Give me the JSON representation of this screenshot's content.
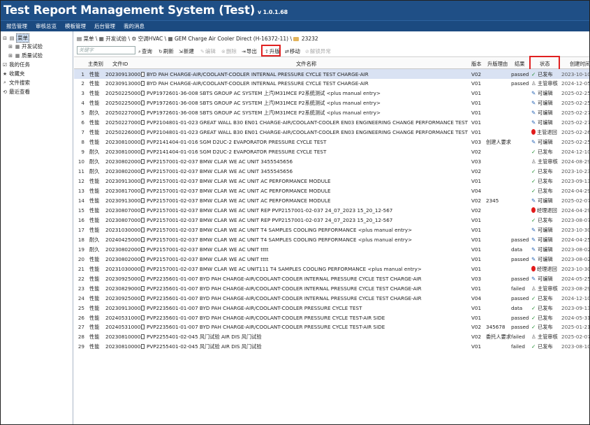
{
  "app": {
    "title": "Test Report Management System (Test)",
    "version": "v 1.0.1.68"
  },
  "nav": [
    "报告管理",
    "审核总览",
    "模板管理",
    "后台管理",
    "我的消息"
  ],
  "sidebar": {
    "items": [
      {
        "label": "菜单",
        "icon": "menu-icon"
      },
      {
        "label": "开发试验",
        "icon": "expand-icon"
      },
      {
        "label": "质量试验",
        "icon": "expand-icon"
      },
      {
        "label": "我的任务",
        "icon": "task-icon"
      },
      {
        "label": "收藏夹",
        "icon": "star-icon"
      },
      {
        "label": "文件搜索",
        "icon": "search-icon"
      },
      {
        "label": "最近查看",
        "icon": "history-icon"
      }
    ]
  },
  "breadcrumb": [
    "菜单",
    "开发试验",
    "空调HVAC",
    "GEM Charge Air Cooler Direct (H-16372-11)",
    "23232"
  ],
  "search": {
    "placeholder": "关键字"
  },
  "toolbar": [
    {
      "label": "查询",
      "glyph": "⌕",
      "enabled": true
    },
    {
      "label": "刷新",
      "glyph": "↻",
      "enabled": true
    },
    {
      "label": "新建",
      "glyph": "⇲",
      "enabled": true
    },
    {
      "label": "编辑",
      "glyph": "✎",
      "enabled": false
    },
    {
      "label": "删除",
      "glyph": "⊗",
      "enabled": false
    },
    {
      "label": "导出",
      "glyph": "⇥",
      "enabled": true
    },
    {
      "label": "升版",
      "glyph": "⇧",
      "enabled": true
    },
    {
      "label": "移动",
      "glyph": "⇄",
      "enabled": true
    },
    {
      "label": "解锁异常",
      "glyph": "⊘",
      "enabled": false
    }
  ],
  "columns": [
    "主类别",
    "文件ID",
    "文件名称",
    "版本",
    "升版理由",
    "结果",
    "状态",
    "创建时间"
  ],
  "status_colors": {
    "published": "#1a8a2a",
    "editable": "#2a66b5",
    "rejected": "#e21b1b"
  },
  "rows": [
    {
      "n": "1",
      "cat": "性能",
      "id": "202309130001",
      "name": "BYD PAH CHARGE-AIR/COOLANT-COOLER INTERNAL PRESSURE CYCLE TEST CHARGE-AIR",
      "ver": "V02",
      "reason": "",
      "result": "passed",
      "status": "已发布",
      "skind": "pub",
      "date": "2023-10-10"
    },
    {
      "n": "2",
      "cat": "性能",
      "id": "202309130001",
      "name": "BYD PAH CHARGE-AIR/COOLANT-COOLER INTERNAL PRESSURE CYCLE TEST CHARGE-AIR",
      "ver": "V01",
      "reason": "",
      "result": "passed",
      "status": "主管审核",
      "skind": "review",
      "date": "2024-12-05"
    },
    {
      "n": "3",
      "cat": "性能",
      "id": "202502250001",
      "name": "PVP1972601-36-008 SBTS GROUP AC SYSTEM 上汽IM31MCE P2系统测试 <plus manual entry>",
      "ver": "V01",
      "reason": "",
      "result": "",
      "status": "可编辑",
      "skind": "edit",
      "date": "2025-02-25"
    },
    {
      "n": "4",
      "cat": "性能",
      "id": "202502250001",
      "name": "PVP1972601-36-008 SBTS GROUP AC SYSTEM 上汽IM31MCE P2系统测试 <plus manual entry>",
      "ver": "V01",
      "reason": "",
      "result": "",
      "status": "可编辑",
      "skind": "edit",
      "date": "2025-02-25"
    },
    {
      "n": "5",
      "cat": "耐久",
      "id": "202502270001",
      "name": "PVP1972601-36-008 SBTS GROUP AC SYSTEM 上汽IM31MCE P2系统测试 <plus manual entry>",
      "ver": "V01",
      "reason": "",
      "result": "",
      "status": "可编辑",
      "skind": "edit",
      "date": "2025-02-27"
    },
    {
      "n": "6",
      "cat": "性能",
      "id": "202502270002",
      "name": "PVP2104801-01-023 GREAT WALL B30 EN01 CHARGE-AIR/COOLANT-COOLER EN03 ENGINEERING CHANGE PERFORMANCE TEST <plus manual entry>",
      "ver": "V01",
      "reason": "",
      "result": "",
      "status": "可编辑",
      "skind": "edit",
      "date": "2025-02-27"
    },
    {
      "n": "7",
      "cat": "性能",
      "id": "202502260001",
      "name": "PVP2104801-01-023 GREAT WALL B30 EN01 CHARGE-AIR/COOLANT-COOLER EN03 ENGINEERING CHANGE PERFORMANCE TEST <plus manual entry>",
      "ver": "V01",
      "reason": "",
      "result": "",
      "status": "主管退回",
      "skind": "reject",
      "date": "2025-02-26"
    },
    {
      "n": "8",
      "cat": "性能",
      "id": "202308100002",
      "name": "PVP2141404-01-016 SGM D2UC-2 EVAPORATOR PRESSURE CYCLE TEST",
      "ver": "V03",
      "reason": "创建人要求",
      "result": "",
      "status": "可编辑",
      "skind": "edit",
      "date": "2025-02-25"
    },
    {
      "n": "9",
      "cat": "耐久",
      "id": "202308100002",
      "name": "PVP2141404-01-016 SGM D2UC-2 EVAPORATOR PRESSURE CYCLE TEST",
      "ver": "V02",
      "reason": "",
      "result": "",
      "status": "已发布",
      "skind": "pub",
      "date": "2024-12-10"
    },
    {
      "n": "10",
      "cat": "耐久",
      "id": "202308020008",
      "name": "PVP2157001-02-037 BMW CLAR WE AC UNIT 3455545656",
      "ver": "V03",
      "reason": "",
      "result": "",
      "status": "主管审核",
      "skind": "review",
      "date": "2024-08-29"
    },
    {
      "n": "11",
      "cat": "耐久",
      "id": "202308020008",
      "name": "PVP2157001-02-037 BMW CLAR WE AC UNIT 3455545656",
      "ver": "V02",
      "reason": "",
      "result": "",
      "status": "已发布",
      "skind": "pub",
      "date": "2023-10-23"
    },
    {
      "n": "12",
      "cat": "性能",
      "id": "202309130002",
      "name": "PVP2157001-02-037 BMW CLAR WE AC UNIT AC PERFORMANCE MODULE",
      "ver": "V01",
      "reason": "",
      "result": "",
      "status": "已发布",
      "skind": "pub",
      "date": "2023-09-13"
    },
    {
      "n": "13",
      "cat": "性能",
      "id": "202308170001",
      "name": "PVP2157001-02-037 BMW CLAR WE AC UNIT AC PERFORMANCE MODULE",
      "ver": "V04",
      "reason": "",
      "result": "",
      "status": "已发布",
      "skind": "pub",
      "date": "2024-04-29"
    },
    {
      "n": "14",
      "cat": "性能",
      "id": "202309130002",
      "name": "PVP2157001-02-037 BMW CLAR WE AC UNIT AC PERFORMANCE MODULE",
      "ver": "V02",
      "reason": "2345",
      "result": "",
      "status": "可编辑",
      "skind": "edit",
      "date": "2025-02-07"
    },
    {
      "n": "15",
      "cat": "性能",
      "id": "202308070001",
      "name": "PVP2157001-02-037 BMW CLAR WE AC UNIT REP PVP2157001-02-037 24_07_2023 15_20_12-567",
      "ver": "V02",
      "reason": "",
      "result": "",
      "status": "经理退回",
      "skind": "reject",
      "date": "2024-04-29"
    },
    {
      "n": "16",
      "cat": "性能",
      "id": "202308070001",
      "name": "PVP2157001-02-037 BMW CLAR WE AC UNIT REP PVP2157001-02-037 24_07_2023 15_20_12-567",
      "ver": "V01",
      "reason": "",
      "result": "",
      "status": "已发布",
      "skind": "pub",
      "date": "2023-08-07"
    },
    {
      "n": "17",
      "cat": "性能",
      "id": "202310300001",
      "name": "PVP2157001-02-037 BMW CLAR WE AC UNIT T4 SAMPLES COOLING PERFORMANCE <plus manual entry>",
      "ver": "V01",
      "reason": "",
      "result": "",
      "status": "可编辑",
      "skind": "edit",
      "date": "2023-10-30"
    },
    {
      "n": "18",
      "cat": "耐久",
      "id": "202404250001",
      "name": "PVP2157001-02-037 BMW CLAR WE AC UNIT T4 SAMPLES COOLING PERFORMANCE <plus manual entry>",
      "ver": "V01",
      "reason": "",
      "result": "passed",
      "status": "可编辑",
      "skind": "edit",
      "date": "2024-04-25"
    },
    {
      "n": "19",
      "cat": "耐久",
      "id": "202308020001",
      "name": "PVP2157001-02-037 BMW CLAR WE AC UNIT tttt",
      "ver": "V01",
      "reason": "",
      "result": "data",
      "status": "可编辑",
      "skind": "edit",
      "date": "2023-08-02"
    },
    {
      "n": "20",
      "cat": "性能",
      "id": "202308020006",
      "name": "PVP2157001-02-037 BMW CLAR WE AC UNIT tttt",
      "ver": "V01",
      "reason": "",
      "result": "passed",
      "status": "可编辑",
      "skind": "edit",
      "date": "2023-08-02"
    },
    {
      "n": "21",
      "cat": "性能",
      "id": "202310300002",
      "name": "PVP2157001-02-037 BMW CLAR WE AC UNIT111 T4 SAMPLES COOLING PERFORMANCE <plus manual entry>",
      "ver": "V01",
      "reason": "",
      "result": "",
      "status": "经理退回",
      "skind": "reject",
      "date": "2023-10-30"
    },
    {
      "n": "22",
      "cat": "性能",
      "id": "202309250001",
      "name": "PVP2235601-01-007 BYD PAH CHARGE-AIR/COOLANT-COOLER INTERNAL PRESSURE CYCLE TEST CHARGE-AIR",
      "ver": "V03",
      "reason": "",
      "result": "passed",
      "status": "可编辑",
      "skind": "edit",
      "date": "2024-05-25"
    },
    {
      "n": "23",
      "cat": "性能",
      "id": "202308290002",
      "name": "PVP2235601-01-007 BYD PAH CHARGE-AIR/COOLANT-COOLER INTERNAL PRESSURE CYCLE TEST CHARGE-AIR",
      "ver": "V01",
      "reason": "",
      "result": "failed",
      "status": "主管审核",
      "skind": "review",
      "date": "2023-08-29"
    },
    {
      "n": "24",
      "cat": "性能",
      "id": "202309250001",
      "name": "PVP2235601-01-007 BYD PAH CHARGE-AIR/COOLANT-COOLER INTERNAL PRESSURE CYCLE TEST CHARGE-AIR",
      "ver": "V04",
      "reason": "",
      "result": "passed",
      "status": "已发布",
      "skind": "pub",
      "date": "2024-12-10"
    },
    {
      "n": "25",
      "cat": "性能",
      "id": "202309130003",
      "name": "PVP2235601-01-007 BYD PAH CHARGE-AIR/COOLANT-COOLER PRESSURE CYCLE TEST",
      "ver": "V01",
      "reason": "",
      "result": "data",
      "status": "已发布",
      "skind": "pub",
      "date": "2023-09-13"
    },
    {
      "n": "26",
      "cat": "性能",
      "id": "202405310001",
      "name": "PVP2235601-01-007 BYD PAH CHARGE-AIR/COOLANT-COOLER PRESSURE CYCLE TEST-AIR SIDE",
      "ver": "V01",
      "reason": "",
      "result": "passed",
      "status": "已发布",
      "skind": "pub",
      "date": "2024-05-31"
    },
    {
      "n": "27",
      "cat": "性能",
      "id": "202405310001",
      "name": "PVP2235601-01-007 BYD PAH CHARGE-AIR/COOLANT-COOLER PRESSURE CYCLE TEST-AIR SIDE",
      "ver": "V02",
      "reason": "345678",
      "result": "passed",
      "status": "已发布",
      "skind": "pub",
      "date": "2025-01-21"
    },
    {
      "n": "28",
      "cat": "性能",
      "id": "202308100001",
      "name": "PVP2255401-02-045 风门试验 AIR DIS 风门试验",
      "ver": "V02",
      "reason": "委托人要求",
      "result": "failed",
      "status": "主管审核",
      "skind": "review",
      "date": "2025-02-07"
    },
    {
      "n": "29",
      "cat": "性能",
      "id": "202308100001",
      "name": "PVP2255401-02-045 风门试验 AIR DIS 风门试验",
      "ver": "V01",
      "reason": "",
      "result": "failed",
      "status": "已发布",
      "skind": "pub",
      "date": "2023-08-10"
    }
  ]
}
